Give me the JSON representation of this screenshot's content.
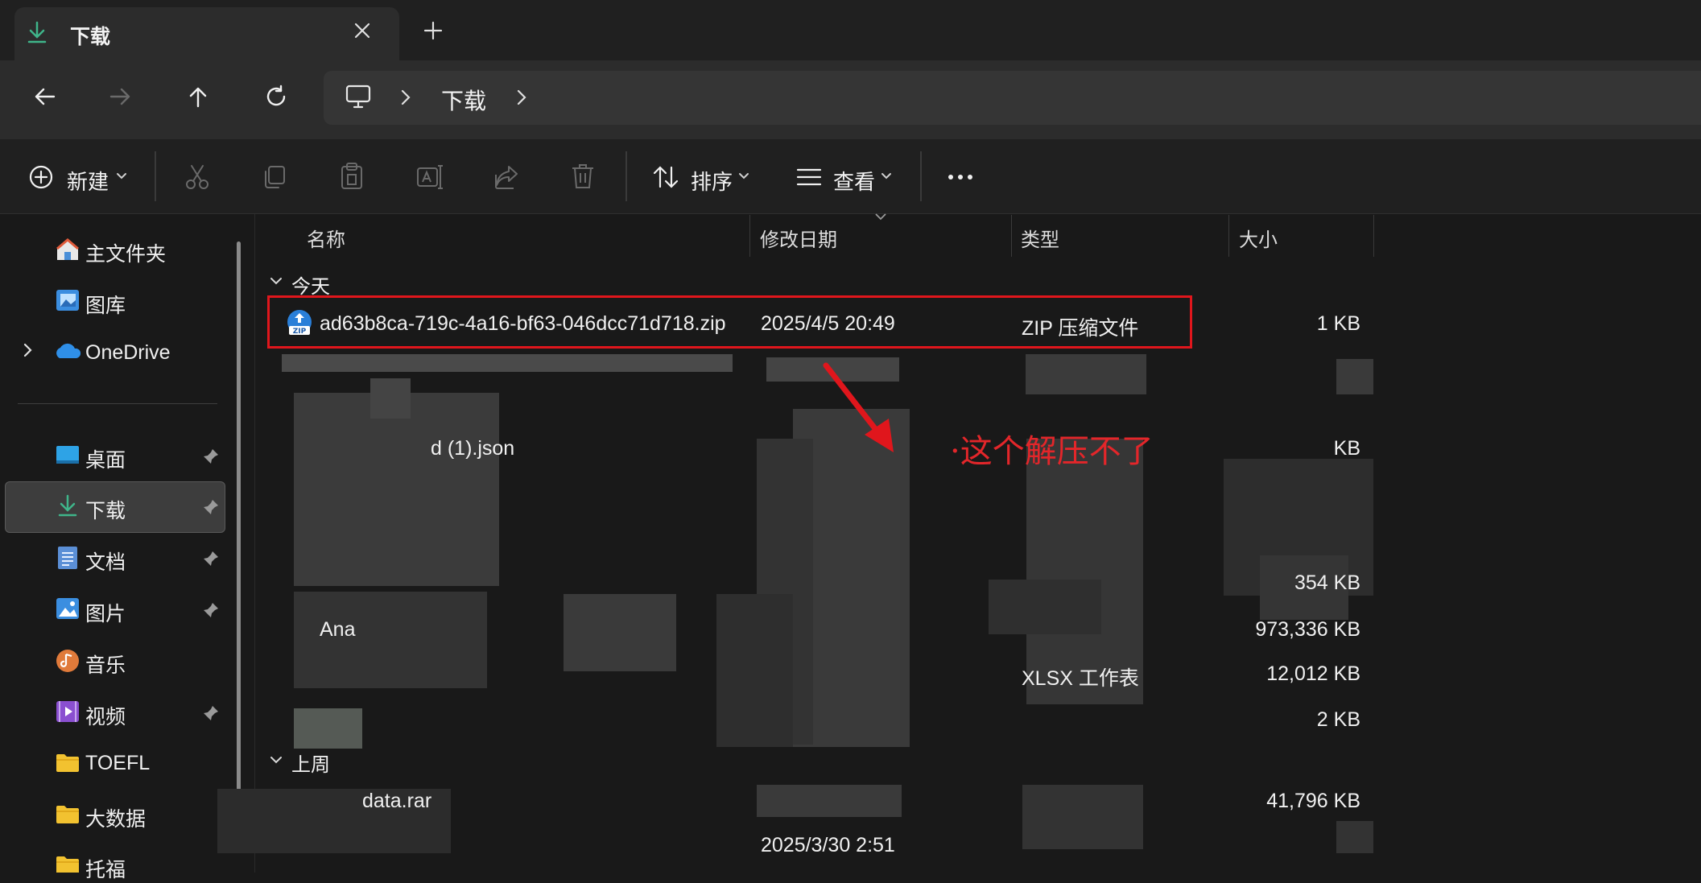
{
  "tab": {
    "title": "下载",
    "close_label": "×",
    "new_label": "+"
  },
  "address": {
    "crumb": "下载"
  },
  "commandbar": {
    "new_label": "新建",
    "sort_label": "排序",
    "view_label": "查看",
    "more_label": "···"
  },
  "sidebar": {
    "items": [
      {
        "label": "主文件夹",
        "icon": "home-icon"
      },
      {
        "label": "图库",
        "icon": "gallery-icon"
      },
      {
        "label": "OneDrive",
        "icon": "cloud-icon"
      },
      {
        "label": "桌面",
        "icon": "desktop-icon"
      },
      {
        "label": "下载",
        "icon": "download-icon"
      },
      {
        "label": "文档",
        "icon": "document-icon"
      },
      {
        "label": "图片",
        "icon": "pictures-icon"
      },
      {
        "label": "音乐",
        "icon": "music-icon"
      },
      {
        "label": "视频",
        "icon": "video-icon"
      },
      {
        "label": "TOEFL",
        "icon": "folder-icon"
      },
      {
        "label": "大数据",
        "icon": "folder-icon"
      },
      {
        "label": "托福",
        "icon": "folder-icon"
      }
    ]
  },
  "columns": {
    "name": "名称",
    "modified": "修改日期",
    "type": "类型",
    "size": "大小"
  },
  "groups": {
    "today": "今天",
    "last_week": "上周"
  },
  "files": {
    "zip": {
      "name": "ad63b8ca-719c-4a16-bf63-046dcc71d718.zip",
      "modified": "2025/4/5 20:49",
      "type": "ZIP 压缩文件",
      "size": "1 KB"
    },
    "visible_fragments": {
      "row2_name": "d (1).json",
      "row2_size": "KB",
      "row7_name": "Ana",
      "row7_size": "973,336 KB",
      "row8_type": "XLSX 工作表",
      "row8_size": "12,012 KB",
      "row9_size": "2 KB",
      "row10_name": "data.rar",
      "row10_size": "41,796 KB",
      "row11_modified": "2025/3/30 2:51",
      "row6_size": "354 KB"
    }
  },
  "annotation": {
    "text": "·这个解压不了"
  },
  "colors": {
    "accent_green": "#3fb58a",
    "annotation_red": "#e0161c"
  }
}
